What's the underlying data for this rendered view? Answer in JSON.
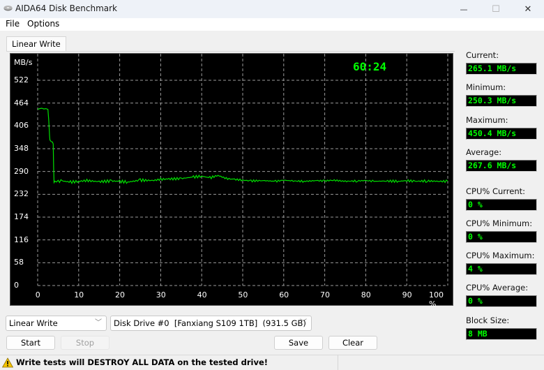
{
  "window": {
    "title": "AIDA64 Disk Benchmark",
    "controls": {
      "minimize": "—",
      "maximize": "☐",
      "close": "✕"
    }
  },
  "menu": {
    "items": [
      "File",
      "Options"
    ]
  },
  "tabs": [
    {
      "label": "Linear Write",
      "active": true
    }
  ],
  "chart_data": {
    "type": "line",
    "title": "",
    "xlabel": "",
    "ylabel": "MB/s",
    "x_tick_labels": [
      "0",
      "10",
      "20",
      "30",
      "40",
      "50",
      "60",
      "70",
      "80",
      "90",
      "100 %"
    ],
    "y_tick_labels": [
      "0",
      "58",
      "116",
      "174",
      "232",
      "290",
      "348",
      "406",
      "464",
      "522"
    ],
    "xlim": [
      0,
      100
    ],
    "ylim": [
      0,
      522
    ],
    "grid": true,
    "elapsed_time": "60:24",
    "line_color": "#00e000",
    "series": [
      {
        "name": "Linear Write",
        "x": [
          0,
          0.5,
          1,
          1.5,
          2,
          2.5,
          2.7,
          2.9,
          3.0,
          3.3,
          3.6,
          3.8,
          3.9,
          4.0,
          4.2,
          5,
          6,
          8,
          10,
          12,
          15,
          18,
          20,
          22,
          25,
          28,
          30,
          32,
          35,
          38,
          40,
          42,
          44,
          46,
          48,
          50,
          52,
          55,
          58,
          60,
          62,
          65,
          68,
          70,
          72,
          75,
          78,
          80,
          82,
          85,
          88,
          90,
          92,
          95,
          98,
          100
        ],
        "y": [
          448,
          450,
          451,
          449,
          450,
          448,
          420,
          380,
          370,
          366,
          365,
          360,
          300,
          262,
          264,
          265,
          266,
          263,
          265,
          267,
          264,
          266,
          265,
          263,
          268,
          267,
          270,
          271,
          272,
          276,
          278,
          274,
          280,
          272,
          270,
          268,
          266,
          267,
          265,
          268,
          266,
          265,
          267,
          266,
          268,
          265,
          266,
          267,
          265,
          266,
          265,
          267,
          265,
          266,
          265,
          265
        ]
      }
    ]
  },
  "stats": [
    {
      "label": "Current:",
      "value": "265.1 MB/s"
    },
    {
      "label": "Minimum:",
      "value": "250.3 MB/s"
    },
    {
      "label": "Maximum:",
      "value": "450.4 MB/s"
    },
    {
      "label": "Average:",
      "value": "267.6 MB/s"
    },
    {
      "label": "CPU% Current:",
      "value": "0 %"
    },
    {
      "label": "CPU% Minimum:",
      "value": "0 %"
    },
    {
      "label": "CPU% Maximum:",
      "value": "4 %"
    },
    {
      "label": "CPU% Average:",
      "value": "0 %"
    },
    {
      "label": "Block Size:",
      "value": "8 MB"
    }
  ],
  "controls": {
    "test_select": "Linear Write",
    "drive_select": "Disk Drive #0  [Fanxiang S109 1TB]  (931.5 GB)",
    "start": "Start",
    "stop": "Stop",
    "save": "Save",
    "clear": "Clear"
  },
  "status": {
    "warning": "Write tests will DESTROY ALL DATA on the tested drive!"
  },
  "colors": {
    "value_text": "#00ff00",
    "chart_bg": "#000000",
    "grid": "#9a9a9a"
  }
}
